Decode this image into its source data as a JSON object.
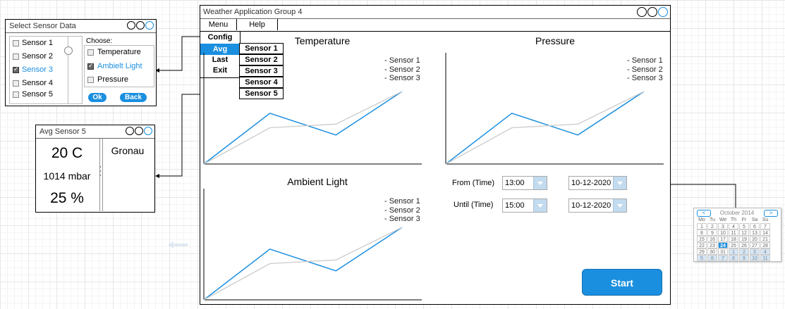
{
  "select_window": {
    "title": "Select Sensor Data",
    "sensors": [
      {
        "label": "Sensor 1",
        "checked": false
      },
      {
        "label": "Sensor 2",
        "checked": false
      },
      {
        "label": "Sensor 3",
        "checked": true
      },
      {
        "label": "Sensor 4",
        "checked": false
      },
      {
        "label": "Sensor 5",
        "checked": false
      }
    ],
    "choose_label": "Choose:",
    "options": [
      {
        "label": "Temperature",
        "checked": false
      },
      {
        "label": "Ambielt Light",
        "checked": true
      },
      {
        "label": "Pressure",
        "checked": false
      }
    ],
    "ok_label": "Ok",
    "back_label": "Back"
  },
  "avg_window": {
    "title": "Avg Sensor 5",
    "temperature": "20 C",
    "pressure": "1014 mbar",
    "humidity": "25 %",
    "location": "Gronau"
  },
  "main_window": {
    "title": "Weather Application Group 4",
    "menubar": {
      "menu": "Menu",
      "help": "Help"
    },
    "menu_items": [
      "Config",
      "Avg",
      "Last",
      "Exit"
    ],
    "submenu_items": [
      "Sensor 1",
      "Sensor 2",
      "Sensor 3",
      "Sensor 4",
      "Sensor 5"
    ],
    "from_label": "From (Time)",
    "until_label": "Until (Time)",
    "from_time": "13:00",
    "until_time": "15:00",
    "from_date": "10-12-2020",
    "until_date": "10-12-2020",
    "start_label": "Start"
  },
  "charts_legend": [
    "- Sensor 1",
    "- Sensor 2",
    "- Sensor 3"
  ],
  "chart_data": [
    {
      "type": "line",
      "title": "Temperature",
      "series_labels": [
        "- Sensor 1",
        "- Sensor 2",
        "- Sensor 3"
      ],
      "series": [
        {
          "values": [
            0,
            0.5,
            0.55,
            1
          ]
        },
        {
          "values": [
            0,
            0.7,
            0.4,
            1
          ]
        }
      ],
      "grid": false
    },
    {
      "type": "line",
      "title": "Pressure",
      "series_labels": [
        "- Sensor 1",
        "- Sensor 2",
        "- Sensor 3"
      ],
      "series": [
        {
          "values": [
            0,
            0.5,
            0.55,
            1
          ]
        },
        {
          "values": [
            0,
            0.7,
            0.4,
            1
          ]
        }
      ],
      "grid": false
    },
    {
      "type": "line",
      "title": "Ambient Light",
      "series_labels": [
        "- Sensor 1",
        "- Sensor 2",
        "- Sensor 3"
      ],
      "series": [
        {
          "values": [
            0,
            0.5,
            0.55,
            1
          ]
        },
        {
          "values": [
            0,
            0.7,
            0.4,
            1
          ]
        }
      ],
      "grid": false
    }
  ],
  "calendar": {
    "month": "October 2014",
    "weekdays": [
      "Mo",
      "Tu",
      "We",
      "Th",
      "Fr",
      "Sa",
      "Su"
    ],
    "days": [
      "1",
      "2",
      "3",
      "4",
      "5",
      "6",
      "7",
      "8",
      "9",
      "10",
      "11",
      "12",
      "13",
      "14",
      "15",
      "16",
      "17",
      "18",
      "19",
      "20",
      "21",
      "22",
      "23",
      "24",
      "25",
      "26",
      "27",
      "28",
      "29",
      "30",
      "31",
      "1",
      "2",
      "3",
      "4",
      "5",
      "6",
      "7",
      "8",
      "9",
      "10",
      "11"
    ],
    "selected": "24"
  },
  "colors": {
    "accent": "#1a8fe0",
    "series_main": "#1a8fe0",
    "series_alt": "#cccccc"
  }
}
